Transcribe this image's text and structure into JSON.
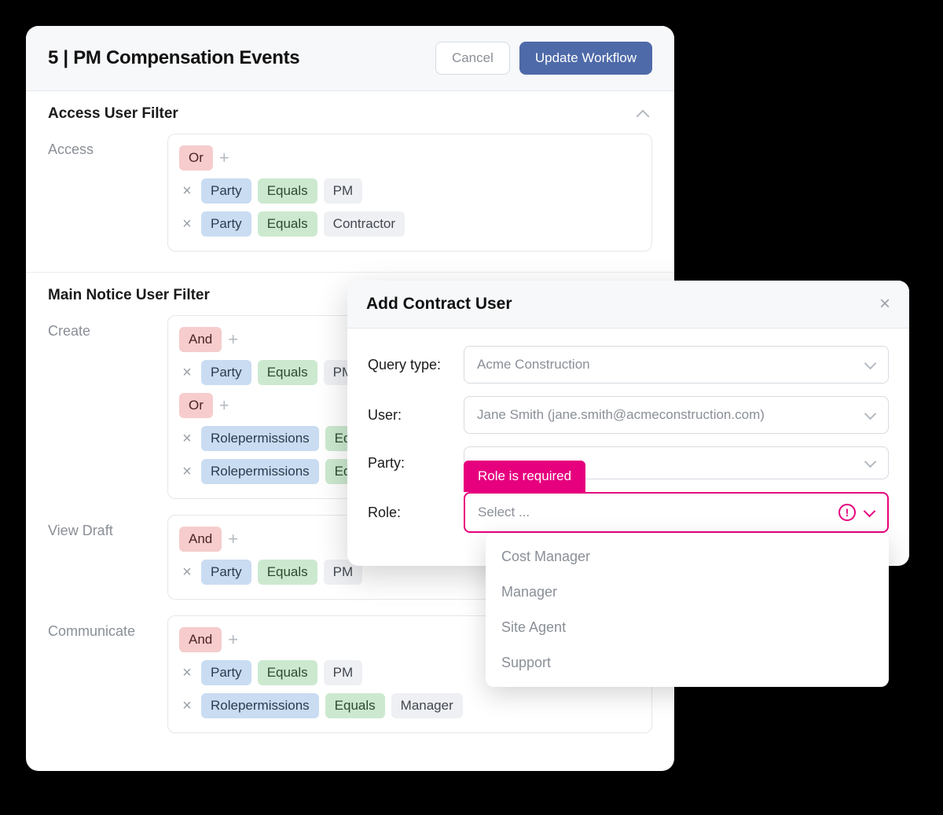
{
  "header": {
    "title": "5 | PM Compensation Events",
    "cancel": "Cancel",
    "update": "Update Workflow"
  },
  "sections": {
    "accessTitle": "Access User Filter",
    "mainNoticeTitle": "Main Notice User Filter"
  },
  "labels": {
    "access": "Access",
    "create": "Create",
    "viewDraft": "View Draft",
    "communicate": "Communicate"
  },
  "tokens": {
    "or": "Or",
    "and": "And",
    "party": "Party",
    "equals": "Equals",
    "rolepermissions": "Rolepermissions",
    "pm": "PM",
    "contractor": "Contractor",
    "manager": "Manager"
  },
  "filters": {
    "access": {
      "logic": "Or",
      "conditions": [
        {
          "field": "Party",
          "op": "Equals",
          "value": "PM"
        },
        {
          "field": "Party",
          "op": "Equals",
          "value": "Contractor"
        }
      ]
    },
    "create": {
      "groups": [
        {
          "logic": "And",
          "conditions": [
            {
              "field": "Party",
              "op": "Equals",
              "value": "PM"
            }
          ]
        },
        {
          "logic": "Or",
          "conditions": [
            {
              "field": "Rolepermissions",
              "op": "Equals"
            },
            {
              "field": "Rolepermissions",
              "op": "Equals"
            }
          ]
        }
      ]
    },
    "viewDraft": {
      "logic": "And",
      "conditions": [
        {
          "field": "Party",
          "op": "Equals",
          "value": "PM"
        }
      ]
    },
    "communicate": {
      "logic": "And",
      "conditions": [
        {
          "field": "Party",
          "op": "Equals",
          "value": "PM"
        },
        {
          "field": "Rolepermissions",
          "op": "Equals",
          "value": "Manager"
        }
      ]
    }
  },
  "modal": {
    "title": "Add Contract User",
    "fields": {
      "queryType": {
        "label": "Query type:",
        "value": "Acme Construction"
      },
      "user": {
        "label": "User:",
        "value": "Jane Smith (jane.smith@acmeconstruction.com)"
      },
      "party": {
        "label": "Party:",
        "value": ""
      },
      "role": {
        "label": "Role:",
        "placeholder": "Select ...",
        "error": "Role is required",
        "options": [
          "Cost Manager",
          "Manager",
          "Site Agent",
          "Support"
        ]
      }
    }
  }
}
